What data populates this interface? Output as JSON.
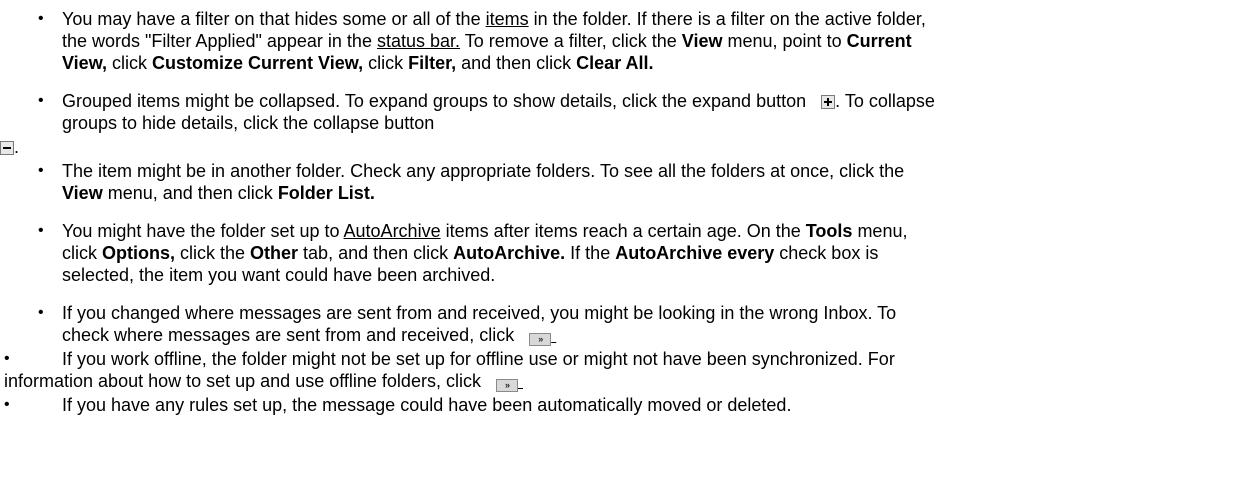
{
  "items": {
    "filter": {
      "l1a": "You may have a filter on that hides some or all of the ",
      "l1_link": "items",
      "l1b": " in the folder. If there is a filter on the active folder,",
      "l2a": "the words \"Filter Applied\" appear in the ",
      "l2_link": "status bar.",
      "l2b": " To remove a filter, click the ",
      "l2_view": "View",
      "l2c": " menu, point to ",
      "l2_current": "Current",
      "l3_view": "View,",
      "l3a": " click ",
      "l3_customize": "Customize Current View,",
      "l3b": " click ",
      "l3_filter": "Filter,",
      "l3c": " and then click ",
      "l3_clear": "Clear All."
    },
    "grouped": {
      "l1a": "Grouped items might be collapsed. To expand groups to show details, click the expand button",
      "l1b": ". To collapse",
      "l2": "groups to hide details, click the collapse button",
      "after": "."
    },
    "another_folder": {
      "l1": "The item might be in another folder. Check any appropriate folders. To see all the folders at once, click the",
      "l2_view": "View",
      "l2a": " menu, and then click ",
      "l2_folder": "Folder List."
    },
    "autoarchive": {
      "l1a": "You might have the folder set up to ",
      "l1_link": "AutoArchive",
      "l1b": " items after items reach a certain age. On the ",
      "l1_tools": "Tools",
      "l1c": " menu,",
      "l2a": "click ",
      "l2_options": "Options,",
      "l2b": " click the ",
      "l2_other": "Other",
      "l2c": " tab, and then click ",
      "l2_auto": "AutoArchive.",
      "l2d": " If the ",
      "l2_every": "AutoArchive every",
      "l2e": " check box is",
      "l3": "selected, the item you want could have been archived."
    },
    "sent_from": {
      "l1": "If you changed where messages are sent from and received, you might be looking in the wrong Inbox. To",
      "l2": "check where messages are sent from and received, click"
    },
    "offline": {
      "l1": "If you work offline, the folder might not be set up for offline use or might not have been synchronized. For",
      "l2": "information about how to set up and use offline folders, click"
    },
    "rules": {
      "l1": "If you have any rules set up, the message could have been automatically moved or deleted."
    }
  },
  "bullet_char": "•",
  "jump_glyph": "»"
}
